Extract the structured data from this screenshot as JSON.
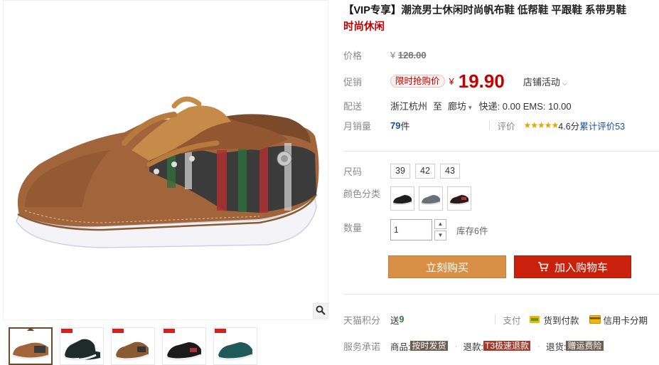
{
  "title": {
    "vip": "【VIP专享】",
    "main": "潮流男士休闲时尚帆布鞋 低帮鞋 平跟鞋 系带男鞋",
    "red": "时尚休闲"
  },
  "price": {
    "label": "价格",
    "currency": "¥",
    "original": "128.00"
  },
  "promo": {
    "label": "促销",
    "tag": "限时抢购价",
    "currency": "¥",
    "price": "19.90",
    "shop_activity": "店铺活动"
  },
  "shipping": {
    "label": "配送",
    "from": "浙江杭州",
    "to_word": "至",
    "destination": "廊坊",
    "fees": "快递: 0.00 EMS: 10.00"
  },
  "sales": {
    "label": "月销量",
    "count": "79",
    "unit": "件",
    "review_label": "评价",
    "rating": "4.6分",
    "review_text": "累计评价",
    "review_count": "53"
  },
  "size": {
    "label": "尺码",
    "options": [
      "39",
      "42",
      "43"
    ]
  },
  "color": {
    "label": "颜色分类"
  },
  "quantity": {
    "label": "数量",
    "value": "1",
    "stock": "库存6件"
  },
  "buttons": {
    "buy": "立刻购买",
    "cart": "加入购物车"
  },
  "points": {
    "label": "天猫积分",
    "send": "送",
    "value": "9"
  },
  "payment": {
    "label": "支付",
    "cod": "货到付款",
    "credit": "信用卡分期"
  },
  "promise": {
    "label": "服务承诺",
    "goods_label": "商品:",
    "goods_badge": "按时发货",
    "refund_label": "退款:",
    "refund_badge": "T3极速退款",
    "return_label": "退货:",
    "return_badge": "赠运费险"
  },
  "colors": {
    "price_red": "#c40000",
    "buy_orange": "#d98f45",
    "cart_red": "#c9210b",
    "link_blue": "#1a4f9c"
  }
}
